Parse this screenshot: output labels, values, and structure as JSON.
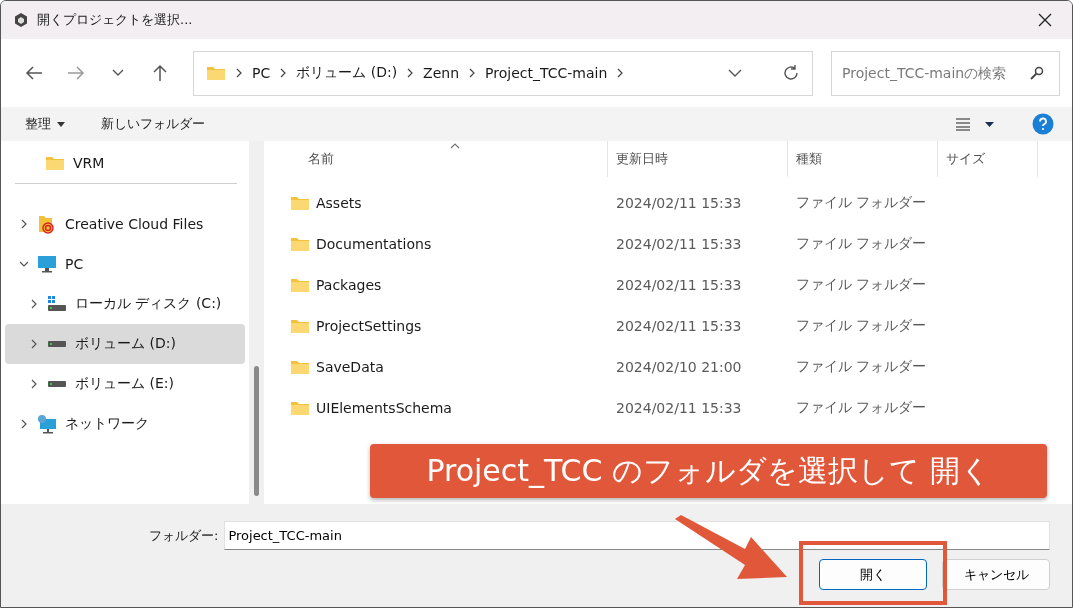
{
  "window": {
    "title": "開くプロジェクトを選択..."
  },
  "breadcrumb": [
    "PC",
    "ボリューム (D:)",
    "Zenn",
    "Project_TCC-main"
  ],
  "search": {
    "placeholder": "Project_TCC-mainの検索"
  },
  "commands": {
    "organize": "整理",
    "new_folder": "新しいフォルダー"
  },
  "sidebar": {
    "top_items": [
      {
        "label": "VRM",
        "kind": "folder",
        "selected": false
      }
    ],
    "items": [
      {
        "label": "Creative Cloud Files",
        "kind": "cloud",
        "expanded": false,
        "selected": false
      },
      {
        "label": "PC",
        "kind": "pc",
        "expanded": true,
        "selected": false,
        "children": [
          {
            "label": "ローカル ディスク (C:)",
            "kind": "system-drive",
            "expanded": false,
            "selected": false
          },
          {
            "label": "ボリューム (D:)",
            "kind": "drive",
            "expanded": false,
            "selected": true
          },
          {
            "label": "ボリューム (E:)",
            "kind": "drive",
            "expanded": false,
            "selected": false
          }
        ]
      },
      {
        "label": "ネットワーク",
        "kind": "network",
        "expanded": false,
        "selected": false
      }
    ]
  },
  "table": {
    "columns": [
      "名前",
      "更新日時",
      "種類",
      "サイズ"
    ],
    "rows": [
      {
        "name": "Assets",
        "modified": "2024/02/11 15:33",
        "type": "ファイル フォルダー"
      },
      {
        "name": "Documentations",
        "modified": "2024/02/11 15:33",
        "type": "ファイル フォルダー"
      },
      {
        "name": "Packages",
        "modified": "2024/02/11 15:33",
        "type": "ファイル フォルダー"
      },
      {
        "name": "ProjectSettings",
        "modified": "2024/02/11 15:33",
        "type": "ファイル フォルダー"
      },
      {
        "name": "SaveData",
        "modified": "2024/02/10 21:00",
        "type": "ファイル フォルダー"
      },
      {
        "name": "UIElementsSchema",
        "modified": "2024/02/11 15:33",
        "type": "ファイル フォルダー"
      }
    ]
  },
  "footer": {
    "folder_label": "フォルダー:",
    "folder_value": "Project_TCC-main",
    "buttons": [
      {
        "label": "開く",
        "kind": "primary"
      },
      {
        "label": "キャンセル",
        "kind": "secondary"
      }
    ]
  },
  "annotation": {
    "text": "Project_TCC のフォルダを選択して 開く"
  }
}
